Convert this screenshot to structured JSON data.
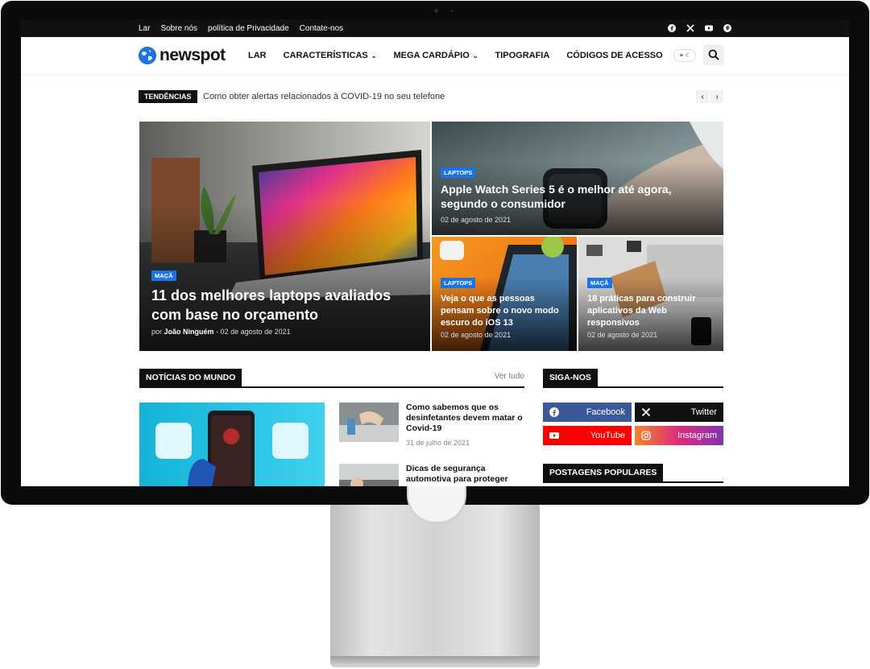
{
  "topbar": {
    "links": [
      "Lar",
      "Sobre nós",
      "política de Privacidade",
      "Contate-nos"
    ],
    "social_icons": [
      "facebook-icon",
      "x-icon",
      "youtube-icon",
      "pinterest-icon"
    ]
  },
  "header": {
    "logo_text": "newspot",
    "nav": [
      {
        "label": "LAR",
        "dropdown": false
      },
      {
        "label": "CARACTERÍSTICAS",
        "dropdown": true
      },
      {
        "label": "MEGA CARDÁPIO",
        "dropdown": true
      },
      {
        "label": "TIPOGRAFIA",
        "dropdown": false
      },
      {
        "label": "CÓDIGOS DE ACESSO",
        "dropdown": false
      }
    ],
    "mode_toggle": "☀ ☾"
  },
  "trending": {
    "tag": "TENDÊNCIAS",
    "text": "Como obter alertas relacionados à COVID-19 no seu telefone",
    "prev": "‹",
    "next": "›"
  },
  "hero": {
    "main": {
      "badge": "MAÇÃ",
      "title": "11 dos melhores laptops avaliados com base no orçamento",
      "by": "por",
      "author": "João Ninguém",
      "date": "- 02 de agosto de 2021"
    },
    "top_right": {
      "badge": "LAPTOPS",
      "title": "Apple Watch Series 5 é o melhor até agora, segundo o consumidor",
      "date": "02 de agosto de 2021"
    },
    "bottom_left": {
      "badge": "LAPTOPS",
      "title": "Veja o que as pessoas pensam sobre o novo modo escuro do iOS 13",
      "date": "02 de agosto de 2021"
    },
    "bottom_right": {
      "badge": "MAÇÃ",
      "title": "18 práticas para construir aplicativos da Web responsivos",
      "date": "02 de agosto de 2021"
    }
  },
  "world_news": {
    "label": "NOTÍCIAS DO MUNDO",
    "see_all": "Ver tudo",
    "posts": [
      {
        "title": "Como sabemos que os desinfetantes devem matar o Covid-19",
        "date": "31 de julho de 2021"
      },
      {
        "title": "Dicas de segurança automotiva para proteger",
        "date": ""
      }
    ]
  },
  "follow": {
    "label": "SIGA-NOS",
    "buttons": [
      {
        "name": "Facebook",
        "color": "#3b5998"
      },
      {
        "name": "Twitter",
        "color": "#111111"
      },
      {
        "name": "YouTube",
        "color": "#ff0000"
      },
      {
        "name": "Instagram",
        "color": "#c13584"
      }
    ]
  },
  "popular": {
    "label": "POSTAGENS POPULARES"
  },
  "colors": {
    "accent": "#1a73e8",
    "topbar": "#111111"
  }
}
